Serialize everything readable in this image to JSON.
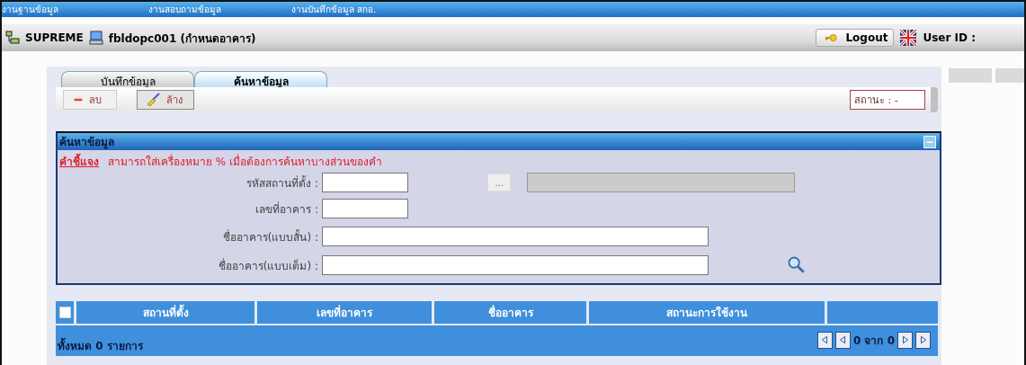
{
  "top_menu": [
    "งานฐานข้อมูล",
    "งานสอบถามข้อมูล",
    "งานบันทึกข้อมูล สกอ."
  ],
  "header": {
    "system": "SUPREME",
    "program": "fbldopc001 (กำหนดอาคาร)",
    "logout": "Logout",
    "user_label": "User ID :"
  },
  "tabs": [
    {
      "label": "บันทึกข้อมูล",
      "selected": false
    },
    {
      "label": "ค้นหาข้อมูล",
      "selected": true
    }
  ],
  "toolbar": {
    "buttons": [
      {
        "label": "ลบ",
        "kind": "delete",
        "disabled": true
      },
      {
        "label": "ล้าง",
        "kind": "clear",
        "disabled": false
      }
    ],
    "status": "สถานะ :  -"
  },
  "search_panel": {
    "title": "ค้นหาข้อมูล",
    "note_label": "คำชี้แจง",
    "note": "สามารถใส่เครื่องหมาย % เมื่อต้องการค้นหาบางส่วนของคำ",
    "fields": [
      {
        "label": "รหัสสถานที่ตั้ง :",
        "kind": "lookup",
        "lookup_button": "..."
      },
      {
        "label": "เลขที่อาคาร :",
        "kind": "short"
      },
      {
        "label": "ชื่ออาคาร(แบบสั้น) :",
        "kind": "long"
      },
      {
        "label": "ชื่ออาคาร(แบบเต็ม) :",
        "kind": "search"
      }
    ]
  },
  "table": {
    "select_all": {
      "checked": false
    },
    "columns": [
      "สถานที่ตั้ง",
      "เลขที่อาคาร",
      "ชื่ออาคาร",
      "สถานะการใช้งาน"
    ],
    "total": "ทั้งหมด  0  รายการ",
    "page": "0 จาก 0"
  }
}
